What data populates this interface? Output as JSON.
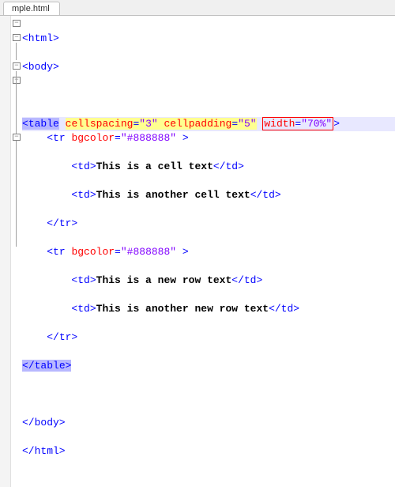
{
  "tab": {
    "filename": "mple.html"
  },
  "code": {
    "l1": {
      "open": "<html>",
      "close": ""
    },
    "l2": {
      "open": "<body>",
      "close": ""
    },
    "l3_blank": "",
    "l4": {
      "tag_open_l": "<",
      "tag_name": "table",
      "sp": " ",
      "attr1_name": "cellspacing",
      "attr1_eq": "=",
      "attr1_val": "\"3\"",
      "attr2_name": "cellpadding",
      "attr2_eq": "=",
      "attr2_val": "\"5\"",
      "attr3_name": "width",
      "attr3_eq": "=",
      "attr3_val": "\"70%\"",
      "tag_close_r": ">"
    },
    "l5": {
      "open": "<tr ",
      "attr": "bgcolor",
      "eq": "=",
      "val": "\"#888888\"",
      "rest": " >"
    },
    "l6": {
      "open": "<td>",
      "text": "This is a cell text",
      "close": "</td>"
    },
    "l7": {
      "open": "<td>",
      "text": "This is another cell text",
      "close": "</td>"
    },
    "l8": {
      "close": "</tr>"
    },
    "l9": {
      "open": "<tr ",
      "attr": "bgcolor",
      "eq": "=",
      "val": "\"#888888\"",
      "rest": " >"
    },
    "l10": {
      "open": "<td>",
      "text": "This is a new row text",
      "close": "</td>"
    },
    "l11": {
      "open": "<td>",
      "text": "This is another new row text",
      "close": "</td>"
    },
    "l12": {
      "close": "</tr>"
    },
    "l13": {
      "close_l": "<",
      "close_name": "/table",
      "close_r": ">"
    },
    "l14_blank": "",
    "l15": {
      "close": "</body>"
    },
    "l16": {
      "close": "</html>"
    }
  }
}
